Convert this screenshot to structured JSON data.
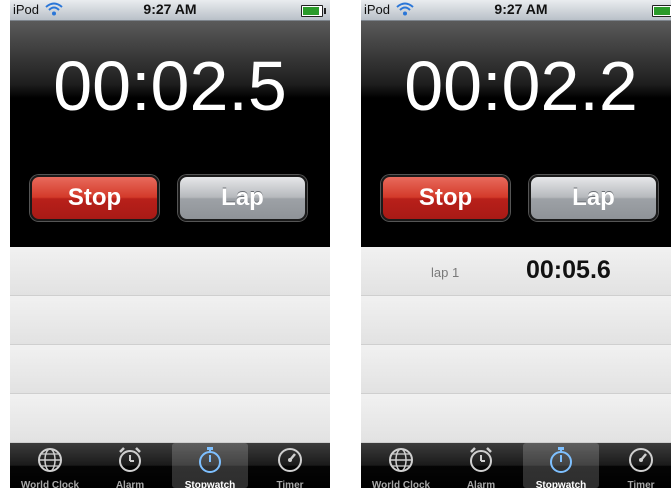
{
  "screens": [
    {
      "status": {
        "carrier": "iPod",
        "time": "9:27 AM"
      },
      "display_time": "00:02.5",
      "buttons": {
        "stop": "Stop",
        "lap": "Lap"
      },
      "laps": [],
      "tabs": [
        "World Clock",
        "Alarm",
        "Stopwatch",
        "Timer"
      ],
      "active_tab": "Stopwatch"
    },
    {
      "status": {
        "carrier": "iPod",
        "time": "9:27 AM"
      },
      "display_time": "00:02.2",
      "buttons": {
        "stop": "Stop",
        "lap": "Lap"
      },
      "laps": [
        {
          "label": "lap 1",
          "time": "00:05.6"
        }
      ],
      "tabs": [
        "World Clock",
        "Alarm",
        "Stopwatch",
        "Timer"
      ],
      "active_tab": "Stopwatch"
    }
  ],
  "colors": {
    "stop_button": "#d33a2a",
    "lap_button": "#b6b9bd",
    "battery_level": "#2a9b2a"
  },
  "icons": [
    "wifi-icon",
    "battery-icon",
    "globe-icon",
    "alarm-clock-icon",
    "stopwatch-icon",
    "timer-icon"
  ]
}
